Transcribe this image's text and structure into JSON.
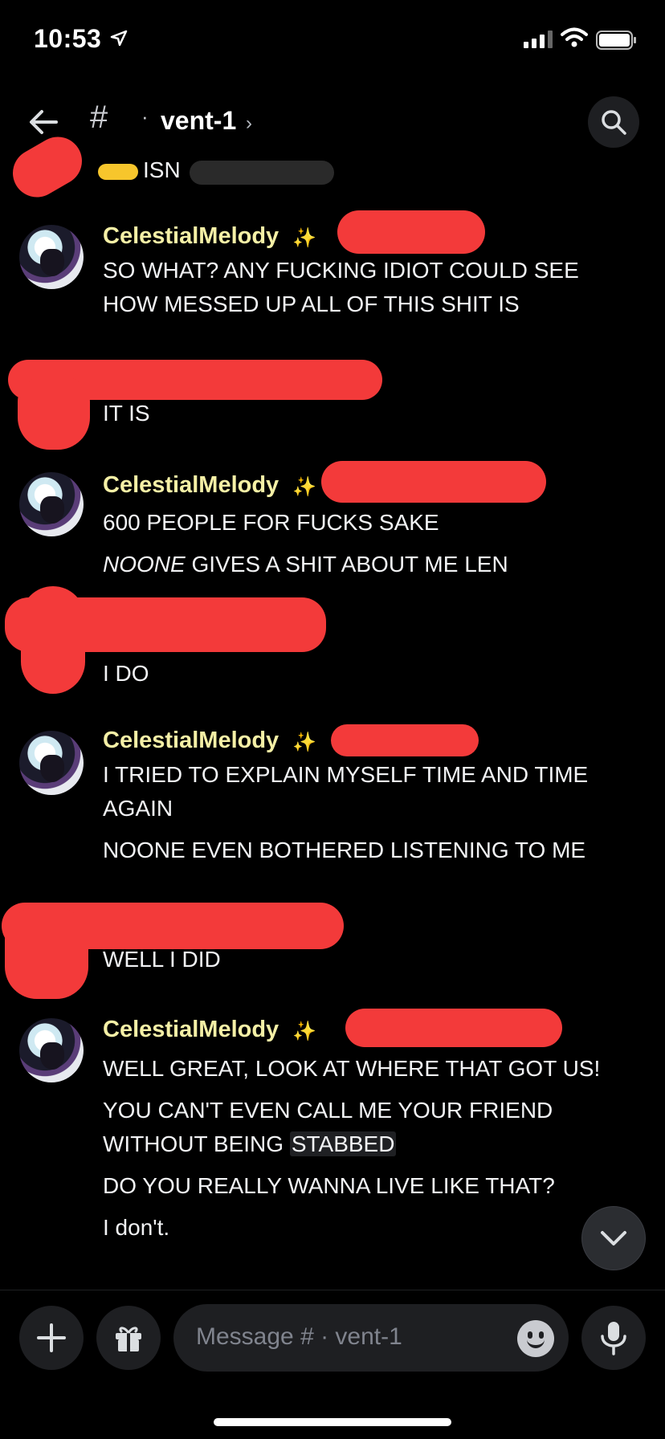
{
  "status_bar": {
    "time": "10:53"
  },
  "header": {
    "hash": "#",
    "dot": "·",
    "channel": "vent-1",
    "chevron": "›"
  },
  "top_partial": {
    "text": "ISN"
  },
  "messages": [
    {
      "author": "CelestialMelody",
      "lines": [
        "SO WHAT? ANY FUCKING IDIOT COULD SEE HOW MESSED UP ALL OF THIS SHIT IS"
      ]
    },
    {
      "author": "",
      "lines": [
        "IT IS"
      ]
    },
    {
      "author": "CelestialMelody",
      "lines": [
        "600 PEOPLE FOR FUCKS SAKE",
        "NOONE",
        " GIVES A SHIT ABOUT ME LEN"
      ]
    },
    {
      "author": "",
      "lines": [
        "I DO"
      ]
    },
    {
      "author": "CelestialMelody",
      "lines": [
        "I TRIED TO EXPLAIN MYSELF TIME AND TIME AGAIN",
        "NOONE EVEN BOTHERED LISTENING TO ME"
      ]
    },
    {
      "author": "",
      "lines": [
        "WELL I DID"
      ]
    },
    {
      "author": "CelestialMelody",
      "lines": [
        "WELL GREAT, LOOK AT WHERE THAT GOT US!",
        "YOU CAN'T EVEN CALL ME YOUR FRIEND WITHOUT BEING ",
        "STABBED",
        "DO YOU REALLY WANNA LIVE LIKE THAT?",
        "I don't."
      ]
    }
  ],
  "sparkle": "✨",
  "composer": {
    "placeholder": "Message # · vent-1"
  },
  "colors": {
    "author": "#f5f0a6",
    "redaction": "#f33a3a",
    "background": "#000000"
  }
}
